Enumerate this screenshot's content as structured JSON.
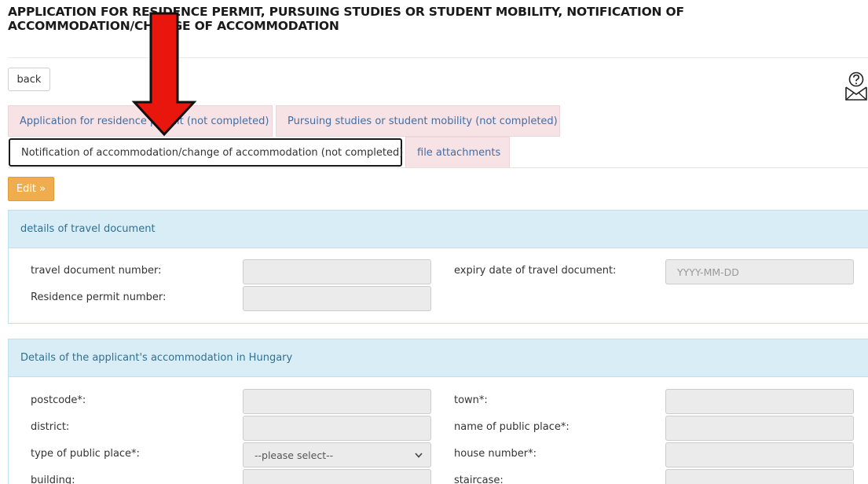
{
  "title": "APPLICATION FOR RESIDENCE PERMIT, PURSUING STUDIES OR STUDENT MOBILITY, NOTIFICATION OF ACCOMMODATION/CHANGE OF ACCOMMODATION",
  "back_label": "back",
  "help_icon": "envelope-question-icon",
  "tabs": [
    {
      "label": "Application for residence permit (not completed)"
    },
    {
      "label": "Pursuing studies or student mobility (not completed)"
    },
    {
      "label": "Notification of accommodation/change of accommodation (not completed)"
    },
    {
      "label": "file attachments"
    }
  ],
  "edit_label": "Edit »",
  "travel": {
    "heading": "details of travel document",
    "travel_doc_number_label": "travel document number:",
    "residence_permit_label": "Residence permit number:",
    "expiry_label": "expiry date of travel document:",
    "expiry_placeholder": "YYYY-MM-DD"
  },
  "accommodation": {
    "heading": "Details of the applicant's accommodation in Hungary",
    "postcode_label": "postcode*:",
    "district_label": "district:",
    "type_label": "type of public place*:",
    "type_value": "--please select--",
    "building_label": "building:",
    "town_label": "town*:",
    "public_place_label": "name of public place*:",
    "house_number_label": "house number*:",
    "staircase_label": "staircase:"
  },
  "colors": {
    "tab_bg": "#f7e3e6",
    "link": "#3f6fa6",
    "edit_button": "#f0ad4e",
    "panel_head": "#d9edf7",
    "annotation_arrow": "#e8160c"
  }
}
